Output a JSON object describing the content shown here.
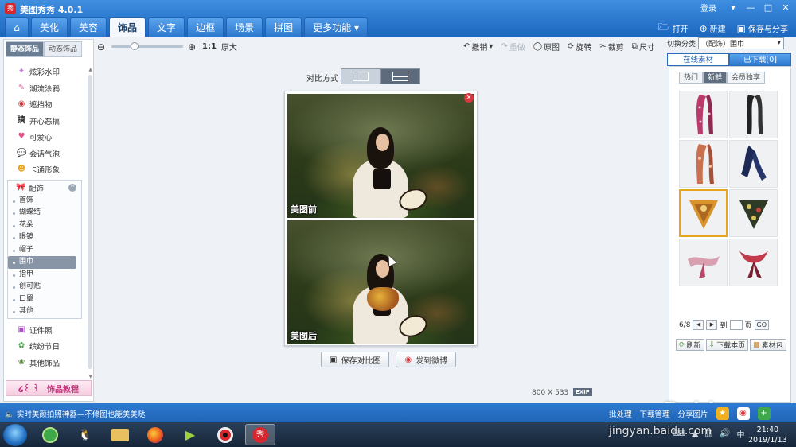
{
  "app": {
    "title": "美图秀秀 4.0.1",
    "logo": "秀",
    "login": "登录"
  },
  "main_tabs": [
    "美化",
    "美容",
    "饰品",
    "文字",
    "边框",
    "场景",
    "拼图",
    "更多功能"
  ],
  "active_tab": "饰品",
  "top_actions": {
    "open": "打开",
    "new": "新建",
    "save_share": "保存与分享"
  },
  "left_panel": {
    "subtabs": [
      "静态饰品",
      "动态饰品"
    ],
    "categories_top": [
      {
        "label": "炫彩水印",
        "icon": "sparkle-icon"
      },
      {
        "label": "潮流涂鸦",
        "icon": "brush-icon"
      },
      {
        "label": "遮挡物",
        "icon": "mask-icon"
      },
      {
        "label": "开心恶搞",
        "icon": "funny-icon"
      },
      {
        "label": "可爱心",
        "icon": "heart-icon"
      },
      {
        "label": "会话气泡",
        "icon": "bubble-icon"
      },
      {
        "label": "卡通形象",
        "icon": "cartoon-icon"
      }
    ],
    "group": {
      "label": "配饰",
      "items": [
        "首饰",
        "蝴蝶结",
        "花朵",
        "眼镜",
        "帽子",
        "围巾",
        "指甲",
        "创可贴",
        "口罩",
        "其他"
      ],
      "active": "围巾"
    },
    "categories_bottom": [
      {
        "label": "证件照",
        "icon": "idphoto-icon"
      },
      {
        "label": "缤纷节日",
        "icon": "gift-icon"
      },
      {
        "label": "其他饰品",
        "icon": "misc-icon"
      }
    ],
    "tutorial": "饰品教程"
  },
  "toolbar": {
    "ratio": "1:1",
    "original_size": "原大",
    "undo": "撤销",
    "redo": "重做",
    "original": "原图",
    "rotate": "旋转",
    "crop": "裁剪",
    "size": "尺寸"
  },
  "compare": {
    "label": "对比方式",
    "before_label": "美图前",
    "after_label": "美图后",
    "save_button": "保存对比图",
    "weibo_button": "发到微博"
  },
  "image_info": {
    "width": "800",
    "x": "X",
    "height": "533",
    "exif": "EXIF"
  },
  "right_panel": {
    "switch_label": "切换分类",
    "category_value": "（配饰）围巾",
    "tabs": [
      "在线素材",
      "已下载[0]"
    ],
    "filters": [
      "热门",
      "新鲜",
      "会员独享"
    ],
    "active_filter": "新鲜",
    "pager": {
      "current": "6/8",
      "to": "到",
      "page": "页",
      "go": "GO"
    },
    "buttons": {
      "refresh": "刷新",
      "download_page": "下载本页",
      "library": "素材包"
    }
  },
  "statusbar": {
    "message": "实时美颜拍照神器—不修图也能美美哒",
    "batch": "批处理",
    "download_manager": "下载管理",
    "share": "分享图片"
  },
  "taskbar": {
    "time": "21:40",
    "date": "2019/1/13"
  },
  "watermark": {
    "text": "Baidu经验",
    "url": "jingyan.baidu.com"
  },
  "colors": {
    "title_blue": "#1b67bf",
    "accent_pink": "#c2307a",
    "selected_gold": "#e5a61e"
  }
}
